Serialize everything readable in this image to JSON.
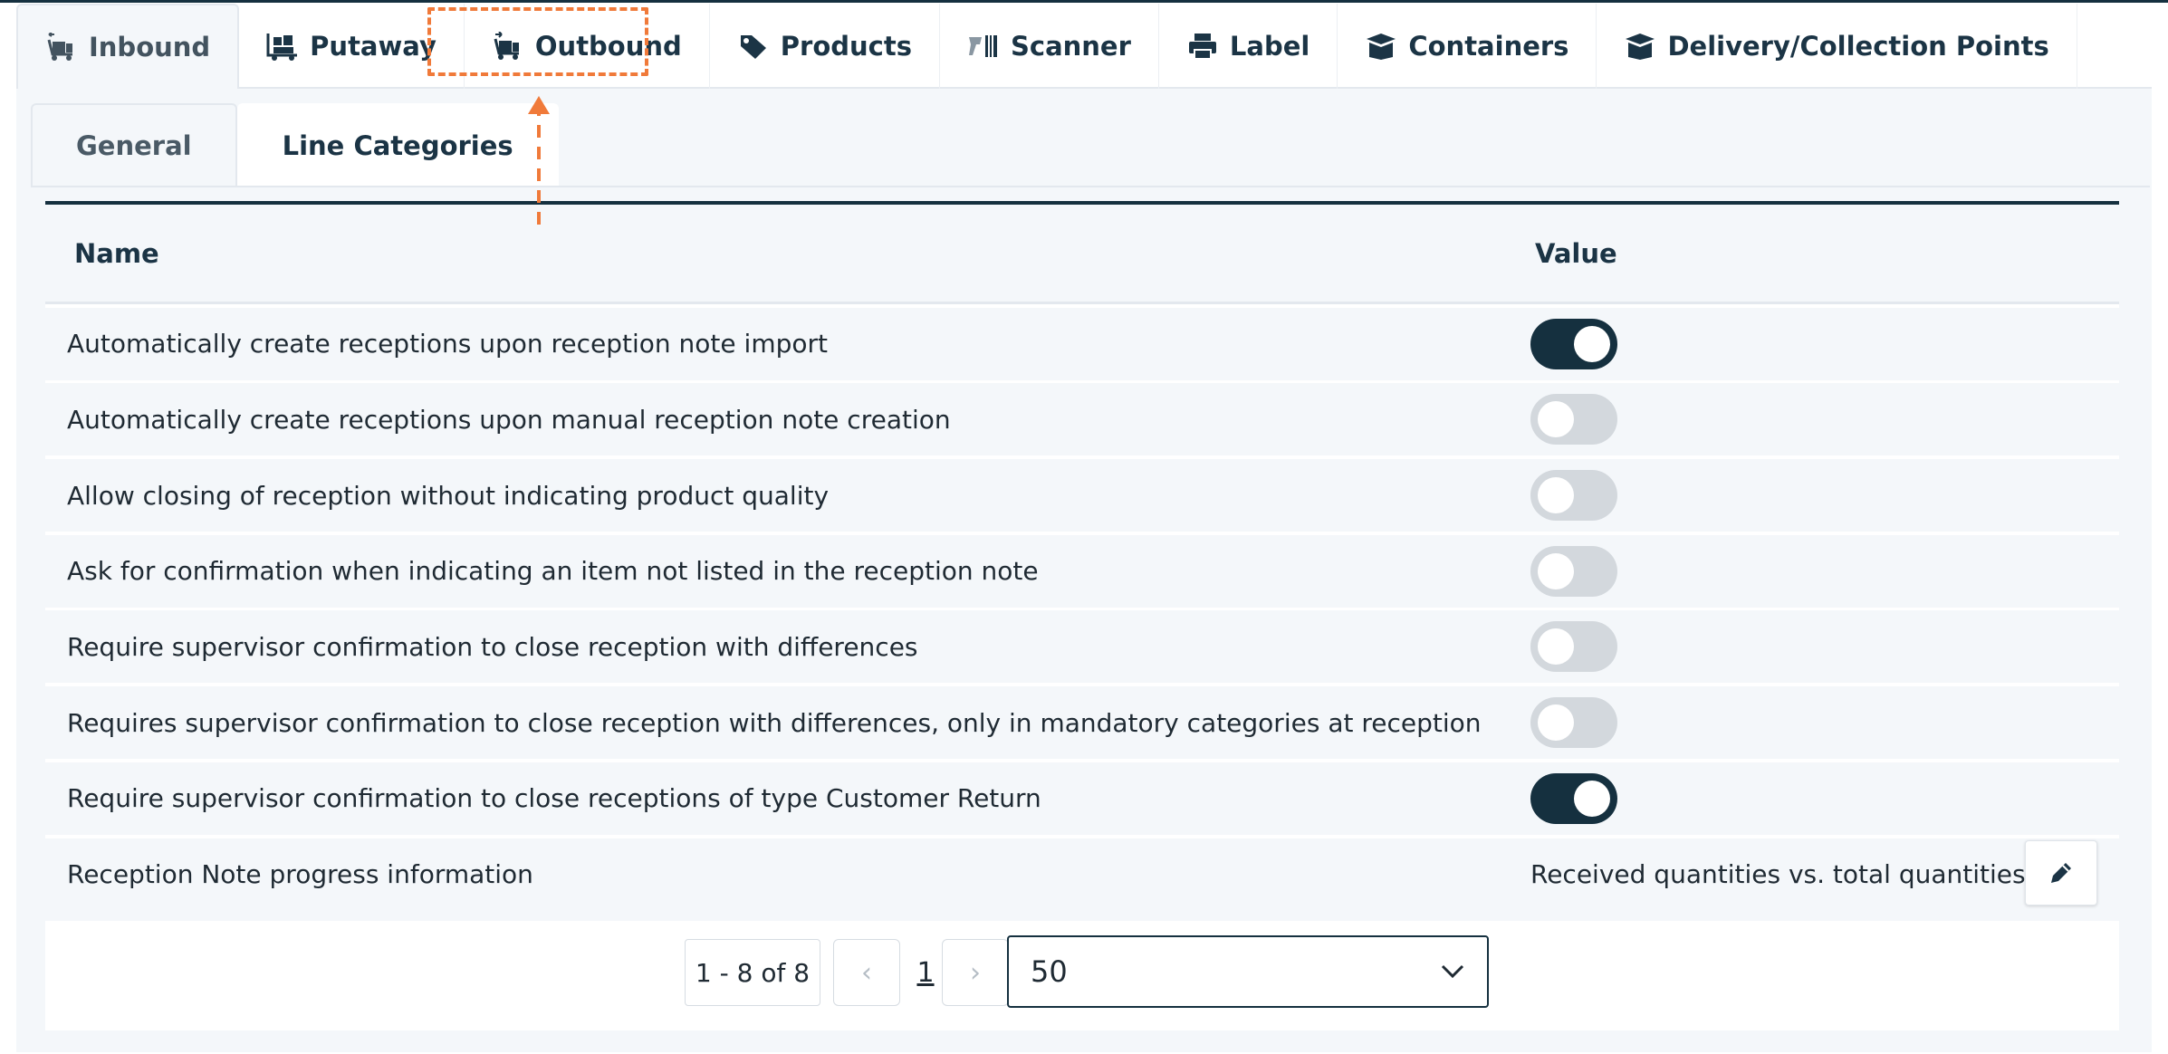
{
  "main_tabs": [
    {
      "label": "Inbound",
      "icon": "inbound-cart-icon",
      "active": true
    },
    {
      "label": "Putaway",
      "icon": "putaway-pallet-icon",
      "active": false
    },
    {
      "label": "Outbound",
      "icon": "outbound-cart-icon",
      "active": false
    },
    {
      "label": "Products",
      "icon": "tag-icon",
      "active": false
    },
    {
      "label": "Scanner",
      "icon": "scanner-icon",
      "active": false
    },
    {
      "label": "Label",
      "icon": "printer-icon",
      "active": false
    },
    {
      "label": "Containers",
      "icon": "box-icon",
      "active": false
    },
    {
      "label": "Delivery/Collection Points",
      "icon": "box-icon",
      "active": false
    }
  ],
  "sub_tabs": [
    {
      "label": "General",
      "active": false
    },
    {
      "label": "Line Categories",
      "active": true
    }
  ],
  "table": {
    "header_name": "Name",
    "header_value": "Value",
    "rows": [
      {
        "name": "Automatically create receptions upon reception note import",
        "toggle": true
      },
      {
        "name": "Automatically create receptions upon manual reception note creation",
        "toggle": false
      },
      {
        "name": "Allow closing of reception without indicating product quality",
        "toggle": false
      },
      {
        "name": "Ask for confirmation when indicating an item not listed in the reception note",
        "toggle": false
      },
      {
        "name": "Require supervisor confirmation to close reception with differences",
        "toggle": false
      },
      {
        "name": "Requires supervisor confirmation to close reception with differences, only in mandatory categories at reception",
        "toggle": false
      },
      {
        "name": "Require supervisor confirmation to close receptions of type Customer Return",
        "toggle": true
      },
      {
        "name": "Reception Note progress information",
        "text_value": "Received quantities vs. total quantities"
      }
    ]
  },
  "pagination": {
    "range": "1 - 8 of 8",
    "prev_symbol": "‹",
    "next_symbol": "›",
    "current_page": "1",
    "page_size": "50"
  },
  "colors": {
    "accent": "#15303f",
    "highlight": "#f07a3a",
    "toggle_off": "#d3d8dd",
    "row_bg": "#f4f7fa"
  }
}
